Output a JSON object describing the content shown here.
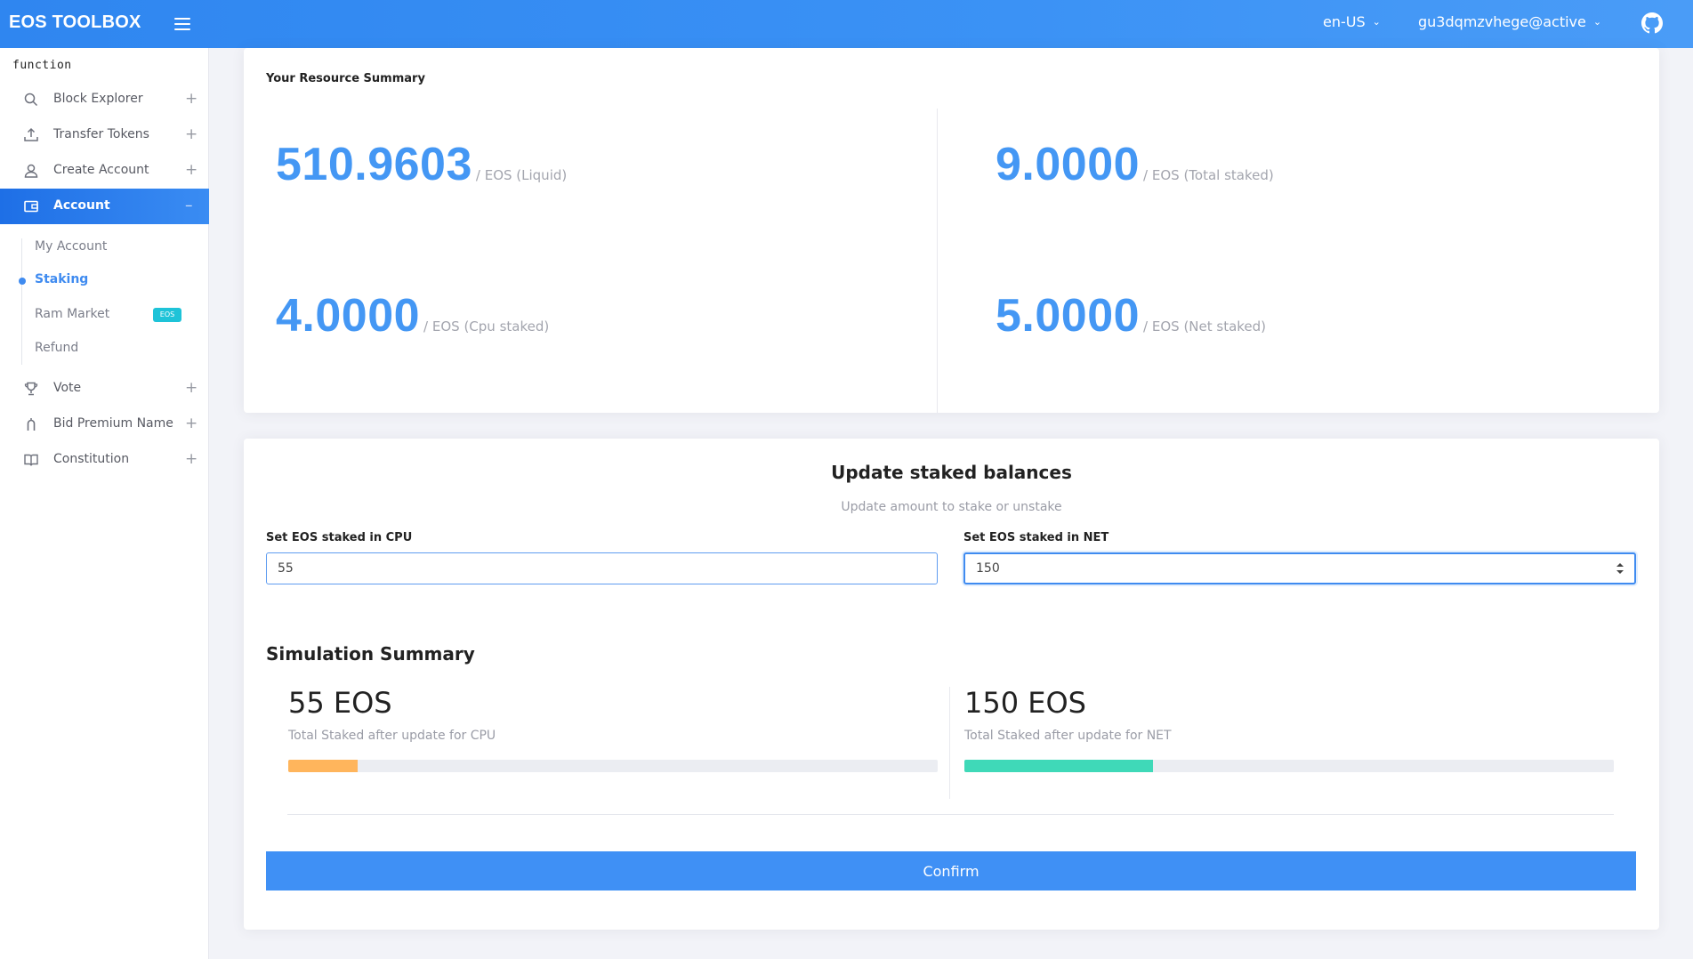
{
  "header": {
    "brand": "EOS TOOLBOX",
    "language": "en-US",
    "account": "gu3dqmzvhege@active"
  },
  "sidebar": {
    "section_title": "function",
    "items": [
      {
        "label": "Block Explorer",
        "icon": "search-icon"
      },
      {
        "label": "Transfer Tokens",
        "icon": "upload-icon"
      },
      {
        "label": "Create Account",
        "icon": "user-icon"
      },
      {
        "label": "Account",
        "icon": "wallet-icon",
        "active": true
      },
      {
        "label": "Vote",
        "icon": "trophy-icon"
      },
      {
        "label": "Bid Premium Name",
        "icon": "gift-icon"
      },
      {
        "label": "Constitution",
        "icon": "book-icon"
      }
    ],
    "sub_items": [
      {
        "label": "My Account"
      },
      {
        "label": "Staking",
        "active": true
      },
      {
        "label": "Ram Market",
        "badge": "EOS"
      },
      {
        "label": "Refund"
      }
    ]
  },
  "resource_summary": {
    "title": "Your Resource Summary",
    "liquid": {
      "value": "510.9603",
      "unit": "/ EOS (Liquid)"
    },
    "total_staked": {
      "value": "9.0000",
      "unit": "/ EOS (Total staked)"
    },
    "cpu_staked": {
      "value": "4.0000",
      "unit": "/ EOS (Cpu staked)"
    },
    "net_staked": {
      "value": "5.0000",
      "unit": "/ EOS (Net staked)"
    }
  },
  "update": {
    "title": "Update staked balances",
    "subtitle": "Update amount to stake or unstake",
    "cpu_label": "Set EOS staked in CPU",
    "cpu_value": "55",
    "net_label": "Set EOS staked in NET",
    "net_value": "150"
  },
  "simulation": {
    "title": "Simulation Summary",
    "cpu": {
      "value": "55 EOS",
      "caption": "Total Staked after update for CPU",
      "progress": 0.107,
      "color": "#ffb55c"
    },
    "net": {
      "value": "150 EOS",
      "caption": "Total Staked after update for NET",
      "progress": 0.291,
      "color": "#3fd9b8"
    }
  },
  "confirm_label": "Confirm",
  "colors": {
    "primary": "#3f8bf0",
    "header": "#3b92f5",
    "confirm": "#3f90f5"
  }
}
